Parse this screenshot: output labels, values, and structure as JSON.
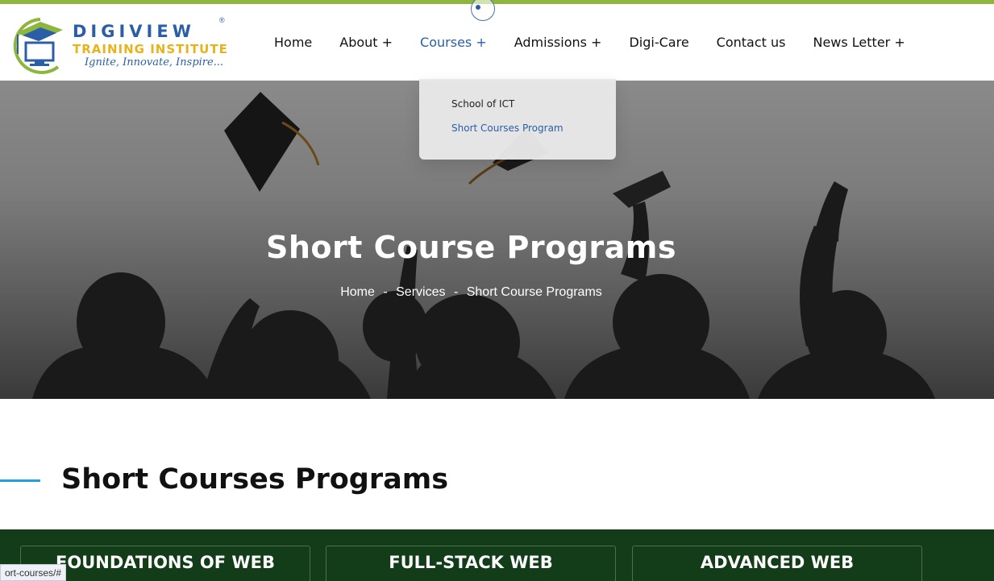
{
  "colors": {
    "accent": "#2b5ea7",
    "top_strip": "#8cb63c",
    "logo_yellow": "#e8b21a",
    "section_line": "#1fa3e0",
    "cards_bg": "#123d18"
  },
  "logo": {
    "word": "DIGIVIEW",
    "registered": "®",
    "sub": "TRAINING INSTITUTE",
    "tagline": "Ignite, Innovate, Inspire..."
  },
  "nav": {
    "items": [
      {
        "label": "Home"
      },
      {
        "label": "About +"
      },
      {
        "label": "Courses +"
      },
      {
        "label": "Admissions +"
      },
      {
        "label": "Digi-Care"
      },
      {
        "label": "Contact us"
      },
      {
        "label": "News Letter +"
      }
    ],
    "active_index": 2
  },
  "dropdown": {
    "items": [
      {
        "label": "School of ICT"
      },
      {
        "label": "Short Courses Program"
      }
    ],
    "selected_index": 1
  },
  "hero": {
    "title": "Short Course Programs",
    "breadcrumb": [
      "Home",
      "Services",
      "Short Course Programs"
    ],
    "separator": "-"
  },
  "section": {
    "title": "Short Courses Programs"
  },
  "cards": [
    {
      "title": "FOUNDATIONS OF WEB"
    },
    {
      "title": "FULL-STACK WEB"
    },
    {
      "title": "ADVANCED WEB"
    }
  ],
  "status_bar": {
    "url": "ort-courses/#"
  }
}
